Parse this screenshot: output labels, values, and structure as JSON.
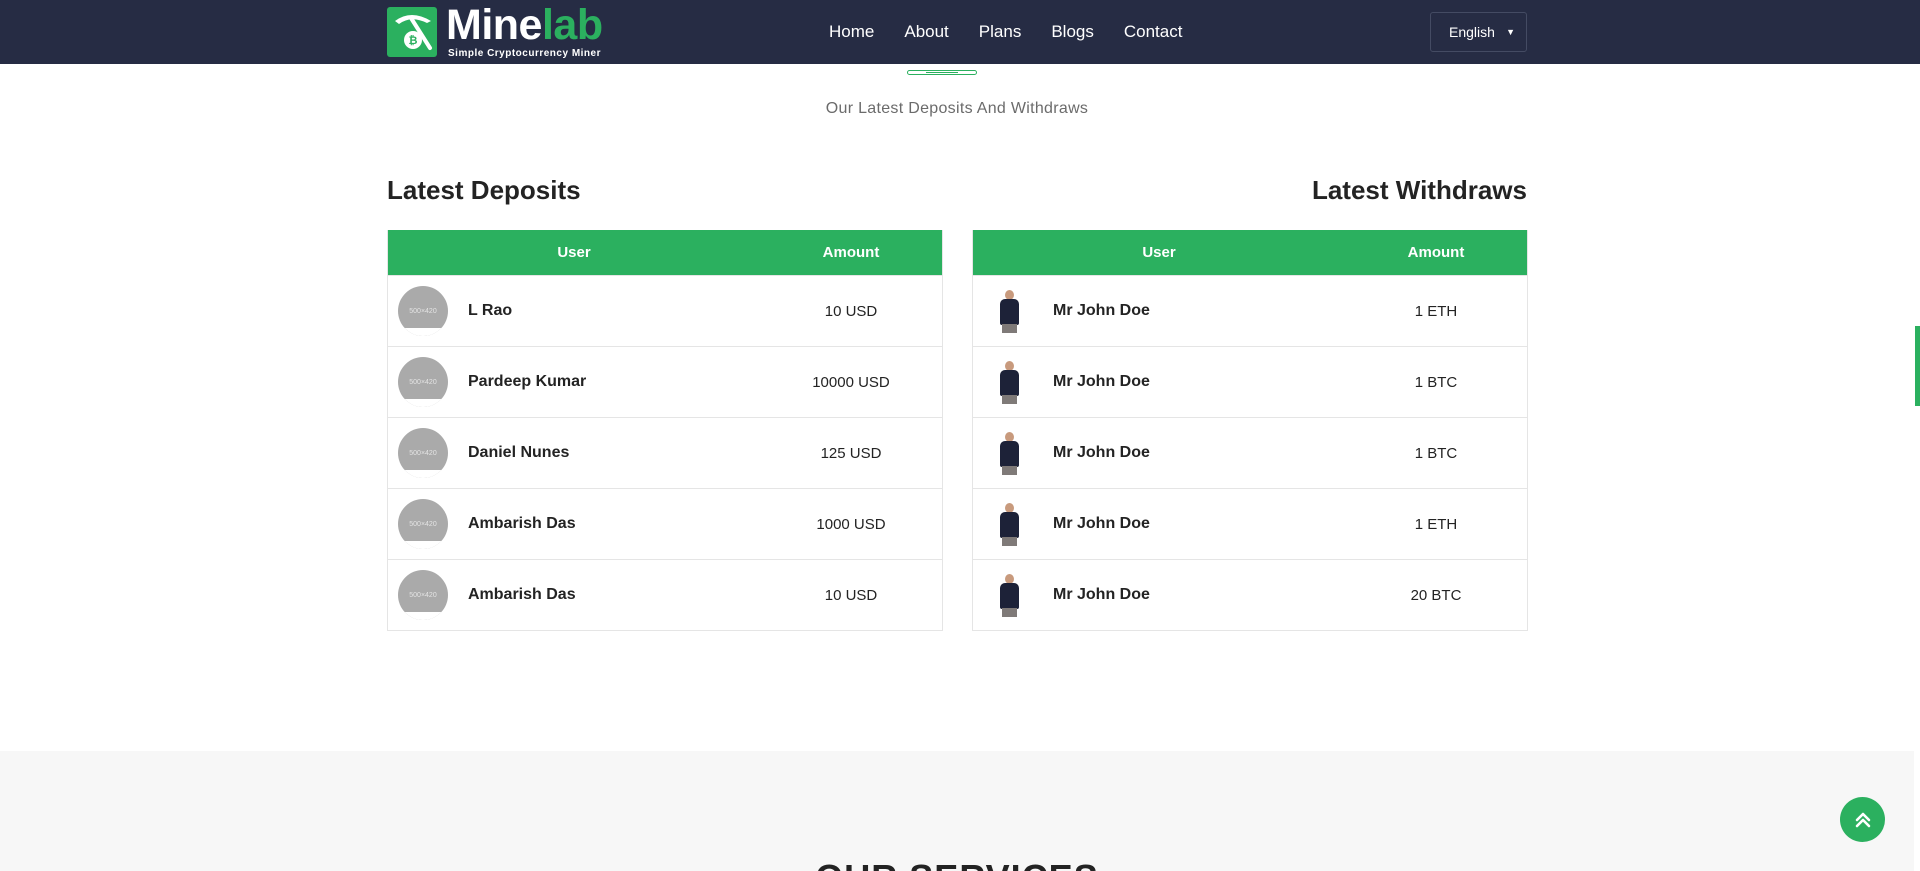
{
  "brand": {
    "name_part1": "Mine",
    "name_part2": "lab",
    "tagline": "Simple Cryptocurrency Miner",
    "accent_color": "#2bb05f",
    "nav_bg_color": "#262c44"
  },
  "nav": {
    "links": [
      "Home",
      "About",
      "Plans",
      "Blogs",
      "Contact"
    ],
    "language": "English"
  },
  "section": {
    "subtitle": "Our Latest Deposits And Withdraws"
  },
  "deposits": {
    "title": "Latest Deposits",
    "col_user": "User",
    "col_amount": "Amount",
    "avatar_placeholder": "500×420",
    "rows": [
      {
        "name": "L Rao",
        "amount": "10 USD"
      },
      {
        "name": "Pardeep Kumar",
        "amount": "10000 USD"
      },
      {
        "name": "Daniel Nunes",
        "amount": "125 USD"
      },
      {
        "name": "Ambarish Das",
        "amount": "1000 USD"
      },
      {
        "name": "Ambarish Das",
        "amount": "10 USD"
      }
    ]
  },
  "withdraws": {
    "title": "Latest Withdraws",
    "col_user": "User",
    "col_amount": "Amount",
    "rows": [
      {
        "name": "Mr John Doe",
        "amount": "1 ETH"
      },
      {
        "name": "Mr John Doe",
        "amount": "1 BTC"
      },
      {
        "name": "Mr John Doe",
        "amount": "1 BTC"
      },
      {
        "name": "Mr John Doe",
        "amount": "1 ETH"
      },
      {
        "name": "Mr John Doe",
        "amount": "20 BTC"
      }
    ]
  },
  "services": {
    "title": "OUR SERVICES"
  },
  "icons": {
    "scroll_top": "double-chevron-up-icon",
    "language_chevron": "chevron-down-icon",
    "logo": "pickaxe-bitcoin-icon"
  }
}
